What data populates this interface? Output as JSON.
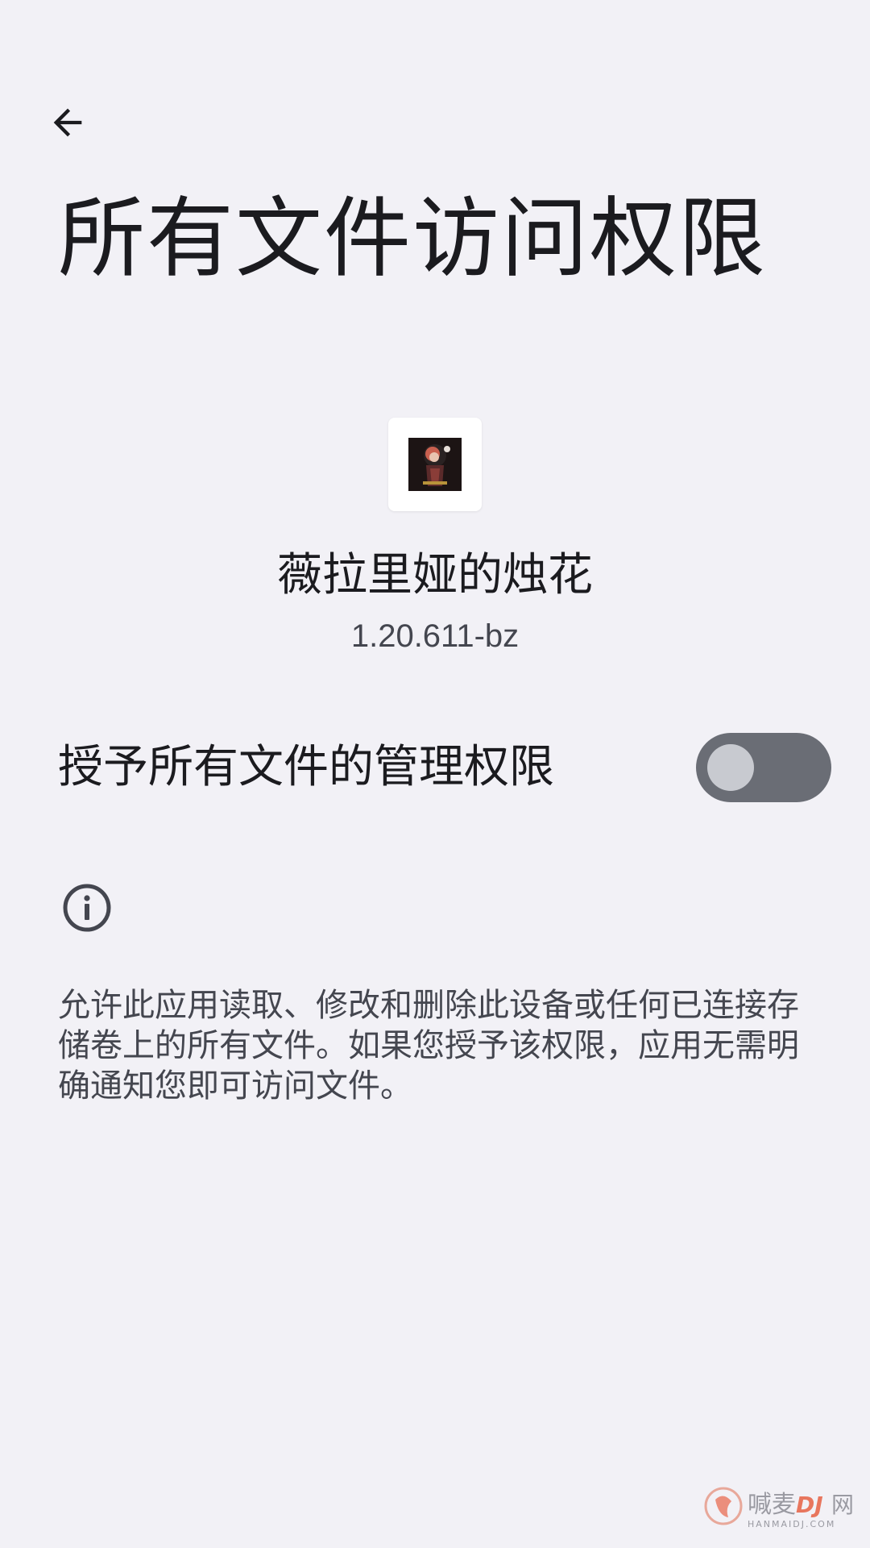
{
  "header": {
    "back_icon": "arrow-back-icon",
    "title": "所有文件访问权限"
  },
  "app": {
    "name": "薇拉里娅的烛花",
    "version": "1.20.611-bz"
  },
  "permission": {
    "label": "授予所有文件的管理权限",
    "enabled": false
  },
  "info": {
    "icon": "info-icon",
    "description": "允许此应用读取、修改和删除此设备或任何已连接存储卷上的所有文件。如果您授予该权限，应用无需明确通知您即可访问文件。"
  },
  "watermark": {
    "text": "喊麦",
    "subtext": "HANMAIDJ.COM"
  },
  "colors": {
    "background": "#f2f1f6",
    "toggle_track": "#6a6d75",
    "toggle_thumb": "#c8cad0",
    "text_primary": "#1b1b1f",
    "text_secondary": "#44464f"
  }
}
